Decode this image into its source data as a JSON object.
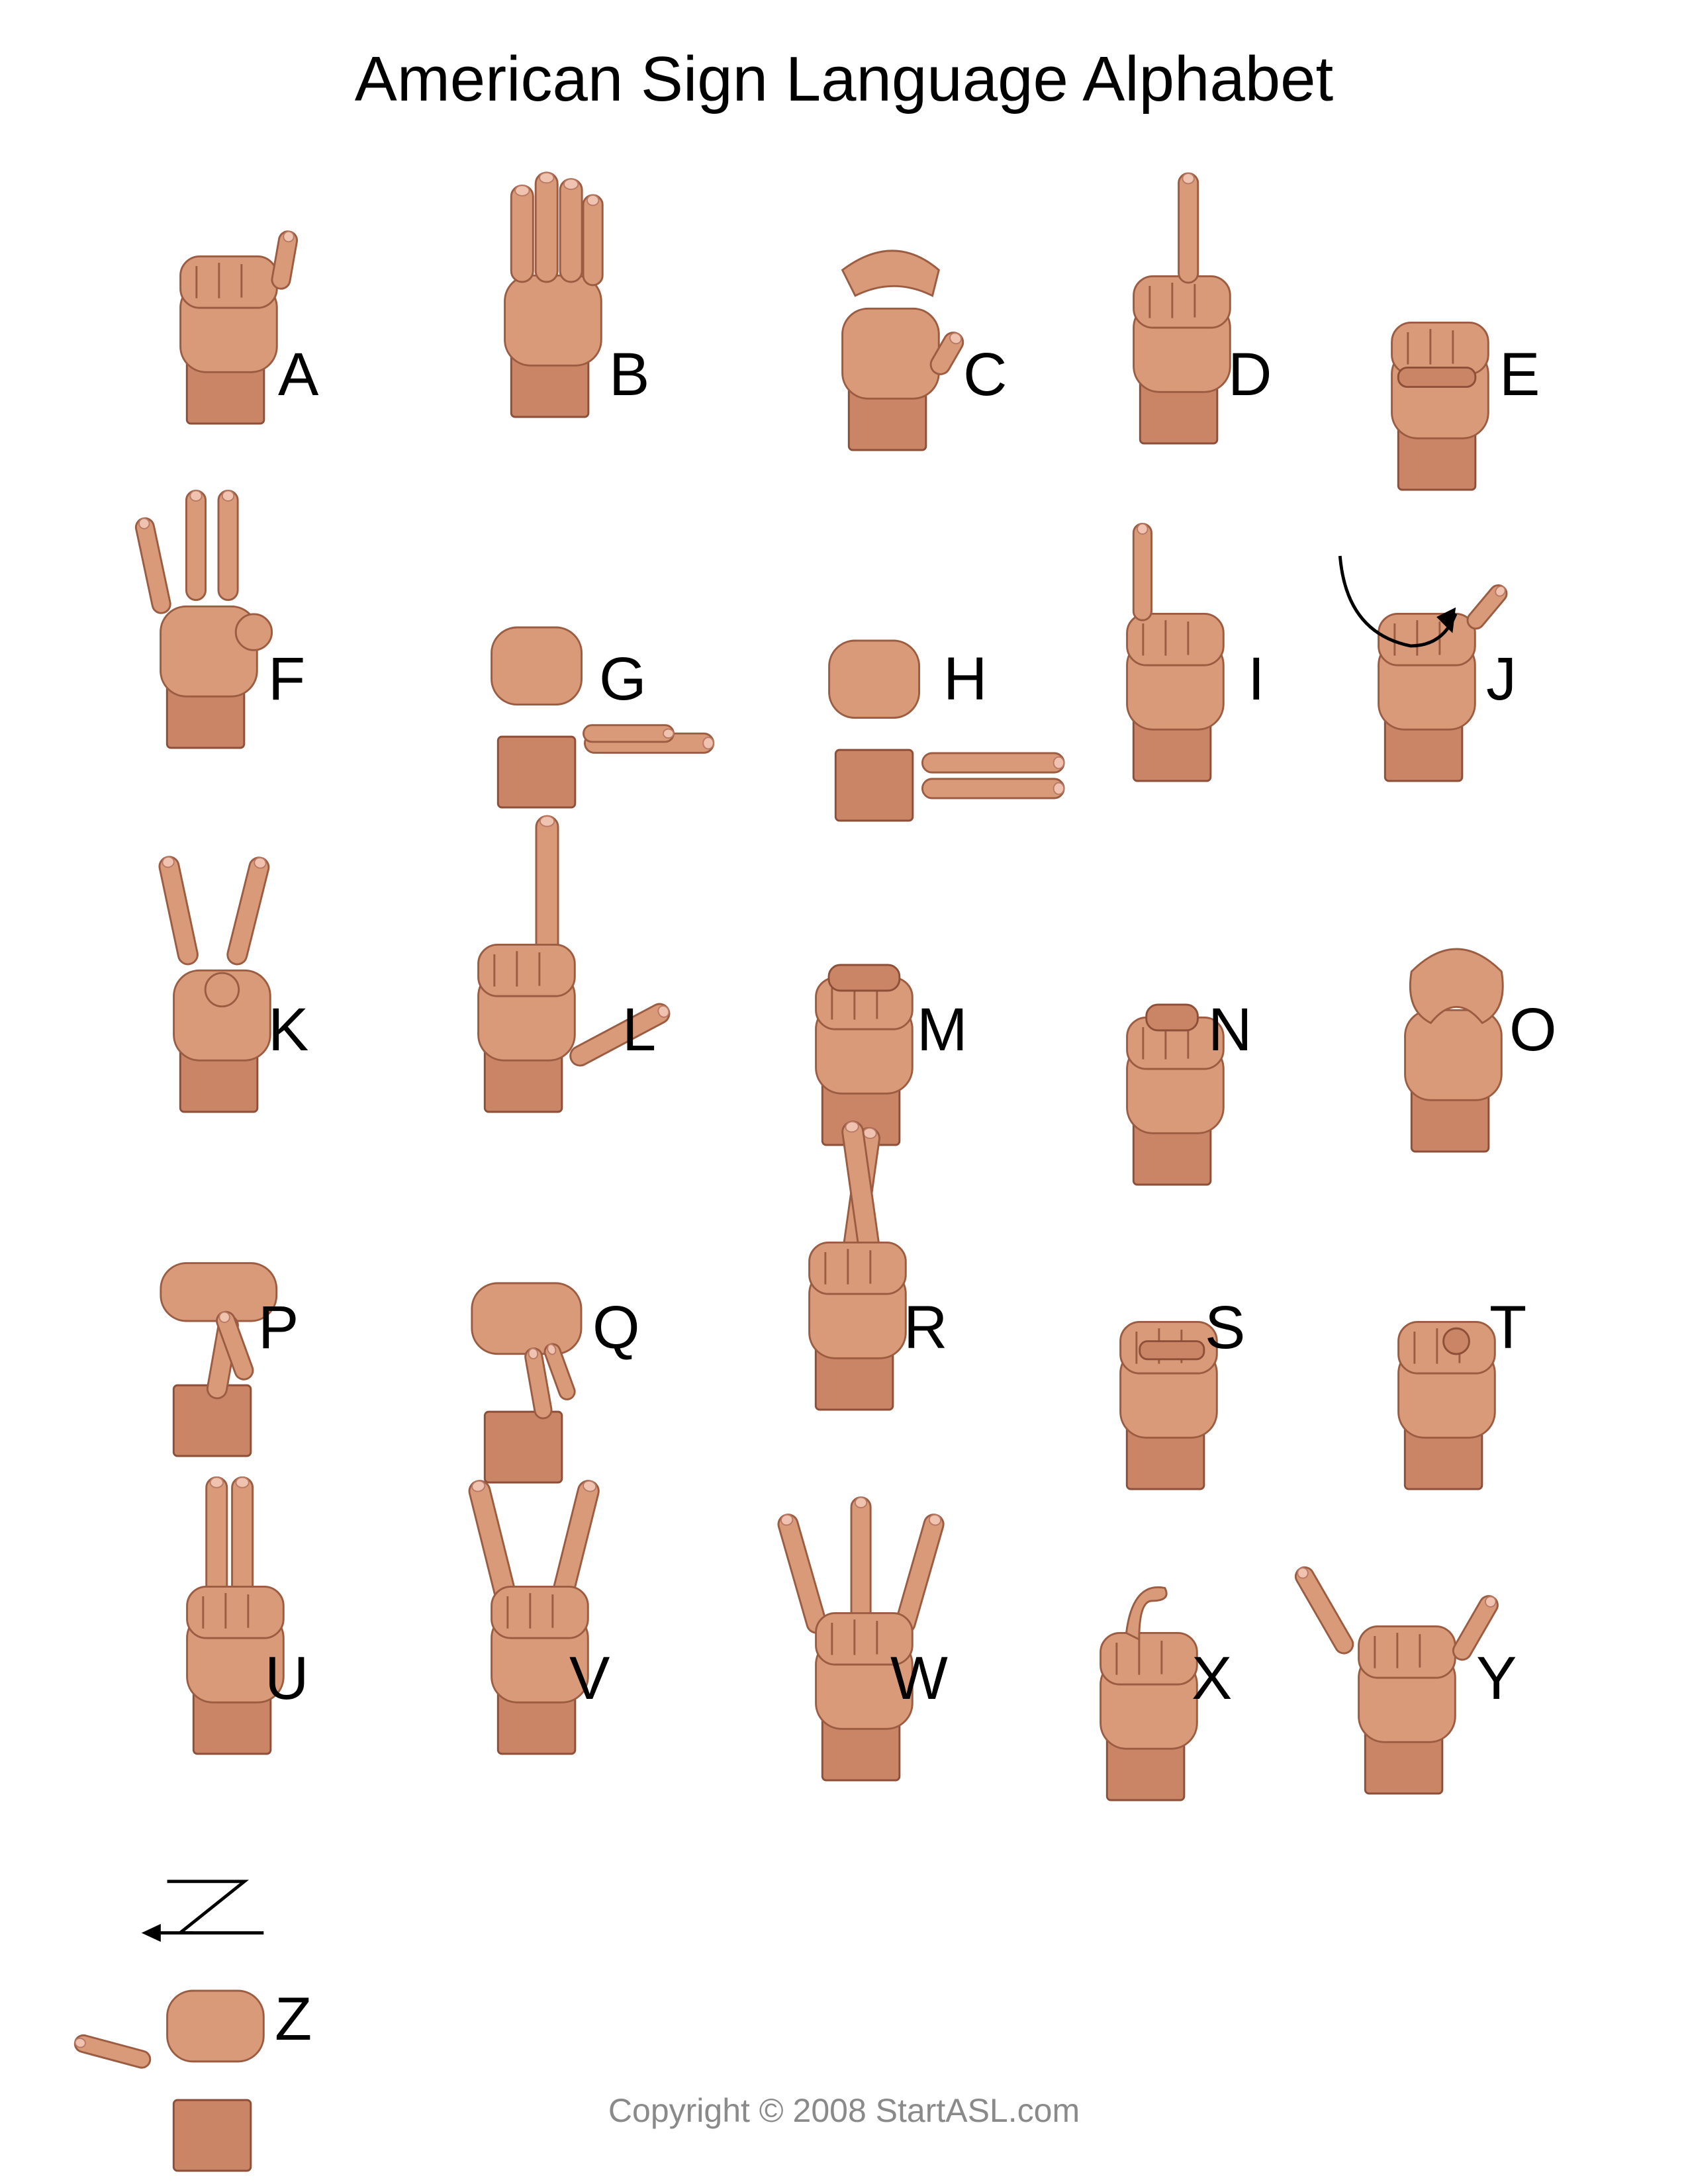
{
  "title": "American Sign Language Alphabet",
  "copyright": "Copyright © 2008 StartASL.com",
  "signs": [
    {
      "letter": "A",
      "icon": "hand-sign-a-icon"
    },
    {
      "letter": "B",
      "icon": "hand-sign-b-icon"
    },
    {
      "letter": "C",
      "icon": "hand-sign-c-icon"
    },
    {
      "letter": "D",
      "icon": "hand-sign-d-icon"
    },
    {
      "letter": "E",
      "icon": "hand-sign-e-icon"
    },
    {
      "letter": "F",
      "icon": "hand-sign-f-icon"
    },
    {
      "letter": "G",
      "icon": "hand-sign-g-icon"
    },
    {
      "letter": "H",
      "icon": "hand-sign-h-icon"
    },
    {
      "letter": "I",
      "icon": "hand-sign-i-icon"
    },
    {
      "letter": "J",
      "icon": "hand-sign-j-icon"
    },
    {
      "letter": "K",
      "icon": "hand-sign-k-icon"
    },
    {
      "letter": "L",
      "icon": "hand-sign-l-icon"
    },
    {
      "letter": "M",
      "icon": "hand-sign-m-icon"
    },
    {
      "letter": "N",
      "icon": "hand-sign-n-icon"
    },
    {
      "letter": "O",
      "icon": "hand-sign-o-icon"
    },
    {
      "letter": "P",
      "icon": "hand-sign-p-icon"
    },
    {
      "letter": "Q",
      "icon": "hand-sign-q-icon"
    },
    {
      "letter": "R",
      "icon": "hand-sign-r-icon"
    },
    {
      "letter": "S",
      "icon": "hand-sign-s-icon"
    },
    {
      "letter": "T",
      "icon": "hand-sign-t-icon"
    },
    {
      "letter": "U",
      "icon": "hand-sign-u-icon"
    },
    {
      "letter": "V",
      "icon": "hand-sign-v-icon"
    },
    {
      "letter": "W",
      "icon": "hand-sign-w-icon"
    },
    {
      "letter": "X",
      "icon": "hand-sign-x-icon"
    },
    {
      "letter": "Y",
      "icon": "hand-sign-y-icon"
    },
    {
      "letter": "Z",
      "icon": "hand-sign-z-icon"
    }
  ],
  "colors": {
    "skin": "#d99a7a",
    "text": "#000000",
    "copyright": "#8a8a8a",
    "background": "#ffffff"
  }
}
